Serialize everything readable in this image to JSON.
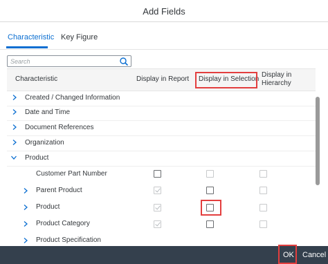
{
  "dialog": {
    "title": "Add Fields"
  },
  "tabs": [
    {
      "label": "Characteristic",
      "active": true
    },
    {
      "label": "Key Figure",
      "active": false
    }
  ],
  "search": {
    "placeholder": "Search"
  },
  "columns": {
    "characteristic": "Characteristic",
    "display_in_report": "Display in Report",
    "display_in_selection": "Display in Selection",
    "display_in_hierarchy_1": "Display in",
    "display_in_hierarchy_2": "Hierarchy"
  },
  "groups": [
    {
      "label": "Created / Changed Information",
      "expanded": false
    },
    {
      "label": "Date and Time",
      "expanded": false
    },
    {
      "label": "Document References",
      "expanded": false
    },
    {
      "label": "Organization",
      "expanded": false
    },
    {
      "label": "Product",
      "expanded": true
    }
  ],
  "items": [
    {
      "label": "Customer Part Number",
      "expandable": false,
      "report": "unchecked",
      "selection": "disabled",
      "hierarchy": "disabled"
    },
    {
      "label": "Parent Product",
      "expandable": true,
      "report": "checked-disabled",
      "selection": "unchecked",
      "hierarchy": "disabled"
    },
    {
      "label": "Product",
      "expandable": true,
      "report": "checked-disabled",
      "selection": "unchecked",
      "hierarchy": "disabled"
    },
    {
      "label": "Product Category",
      "expandable": true,
      "report": "checked-disabled",
      "selection": "unchecked",
      "hierarchy": "disabled"
    },
    {
      "label": "Product Specification",
      "expandable": true,
      "report": "",
      "selection": "",
      "hierarchy": ""
    }
  ],
  "footer": {
    "ok_label": "OK",
    "cancel_label": "Cancel"
  },
  "colors": {
    "accent": "#0a6ed1",
    "highlight": "#e33e3e",
    "footer_bg": "#34404d"
  },
  "icons": {
    "search": "magnifier-icon",
    "collapsed": "chevron-right-icon",
    "expanded": "chevron-down-icon"
  }
}
